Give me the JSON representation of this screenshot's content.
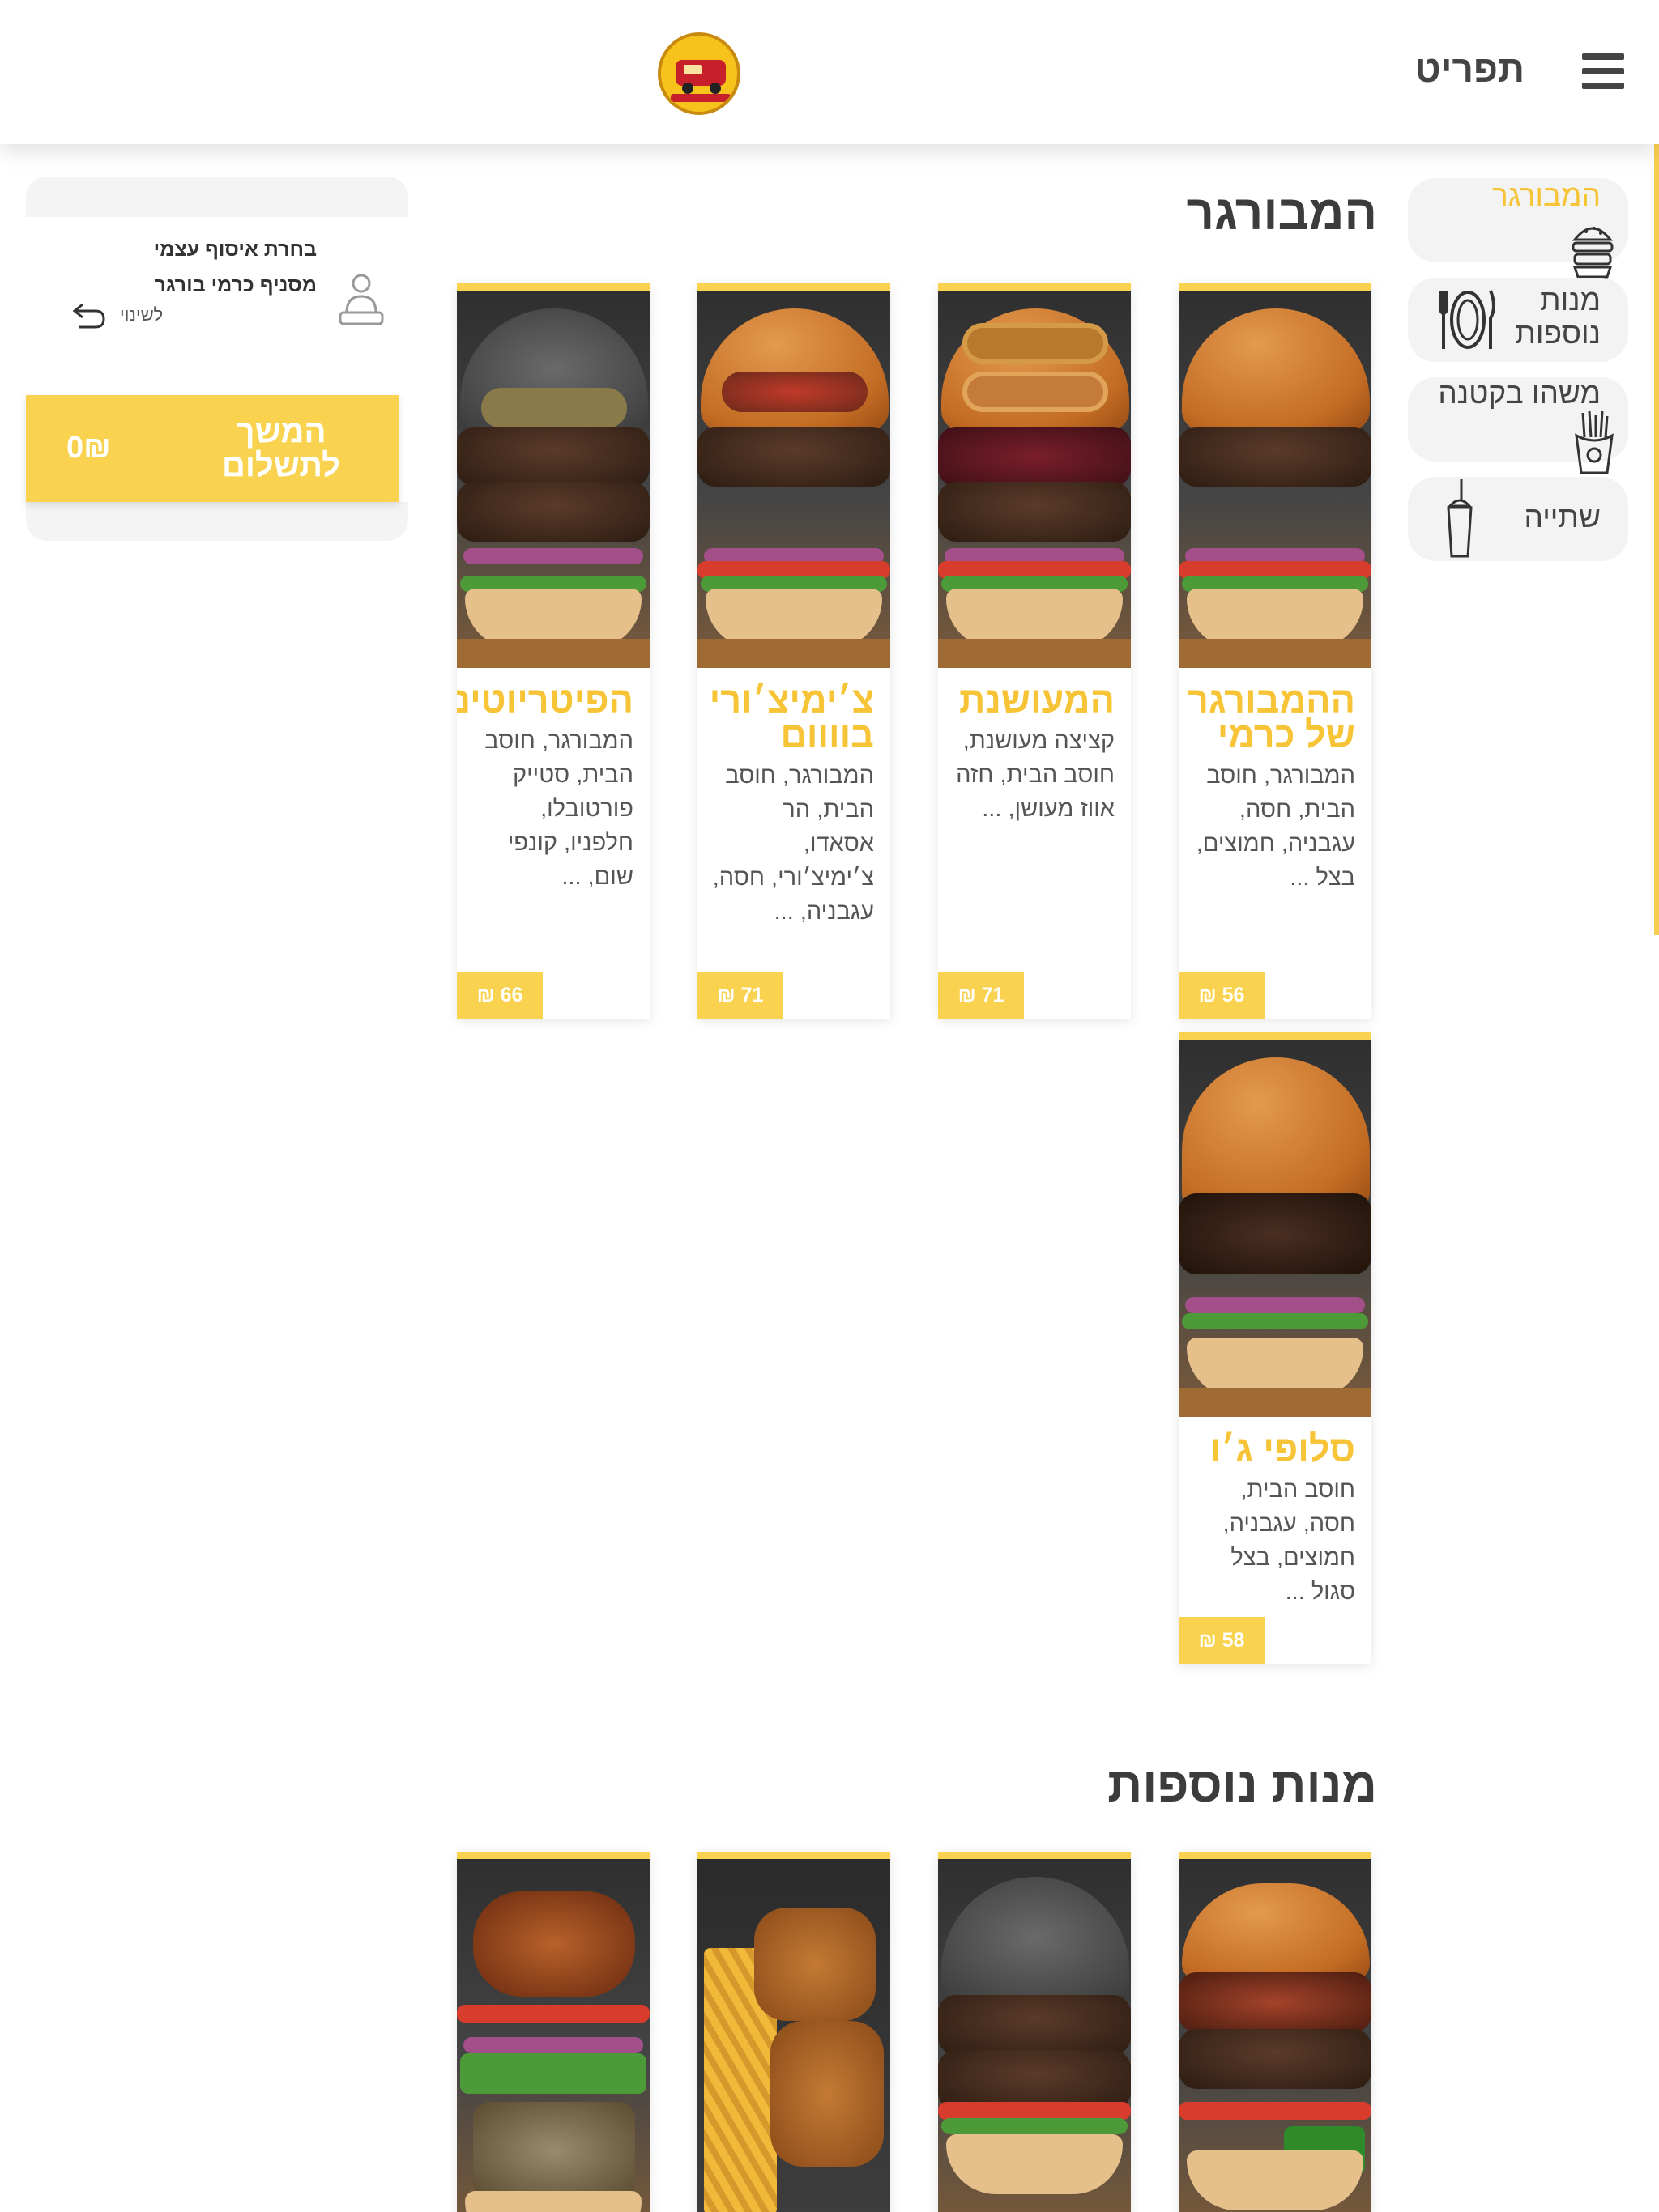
{
  "header": {
    "menu_title": "תפריט",
    "logo_alt": "HOT BURGER"
  },
  "categories": [
    {
      "label": "המבורגר",
      "icon": "burger-icon",
      "active": true
    },
    {
      "label": "מנות נוספות",
      "icon": "plate-cutlery-icon",
      "active": false
    },
    {
      "label": "משהו בקטנה",
      "icon": "fries-icon",
      "active": false
    },
    {
      "label": "שתייה",
      "icon": "cup-straw-icon",
      "active": false
    }
  ],
  "cart": {
    "pickup_text": "בחרת איסוף עצמי מסניף כרמי בורגר",
    "change_label": "לשינוי",
    "checkout_label": "המשך לתשלום",
    "total": "0₪"
  },
  "sections": [
    {
      "title": "המבורגר",
      "products": [
        {
          "name": "ההמבורגר של כרמי",
          "description": "המבורגר, חוסב הבית, חסה, עגבניה, חמוצים, בצל ...",
          "price": "₪ 56"
        },
        {
          "name": "המעושנת",
          "description": "קציצה מעושנת, חוסב הבית, חזה אווז מעושן, ...",
          "price": "₪ 71"
        },
        {
          "name": "צ׳ימיצ׳ורי בוווום",
          "description": "המבורגר, חוסב הבית, הר אסאדו, צ׳ימיצ׳ורי, חסה, עגבניה, ...",
          "price": "₪ 71"
        },
        {
          "name": "הפיטריוטים",
          "description": "המבורגר, חוסב הבית, סטייק פורטובלו, חלפניו, קונפי שום, ...",
          "price": "₪ 66"
        },
        {
          "name": "סלופי ג׳ו",
          "description": "חוסב הבית, חסה, עגבניה, חמוצים, בצל סגול ...",
          "price": "₪ 58"
        }
      ]
    },
    {
      "title": "מנות נוספות",
      "products": []
    }
  ],
  "colors": {
    "accent": "#f9d34f",
    "accent_text": "#f7c437",
    "header_text": "#444444"
  }
}
